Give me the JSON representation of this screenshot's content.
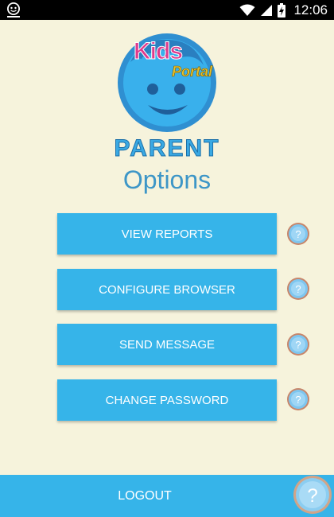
{
  "status_bar": {
    "time": "12:06",
    "icons": [
      "app-notification-icon",
      "wifi-icon",
      "cell-signal-icon",
      "battery-charging-icon"
    ]
  },
  "logo": {
    "kids": "Kids",
    "portal": "Portal"
  },
  "header": {
    "brand": "PARENT",
    "title": "Options"
  },
  "options": {
    "view_reports": "VIEW REPORTS",
    "configure_browser": "CONFIGURE BROWSER",
    "send_message": "SEND MESSAGE",
    "change_password": "CHANGE PASSWORD"
  },
  "footer": {
    "logout": "LOGOUT"
  },
  "colors": {
    "accent": "#36b4e9",
    "background": "#f6f3dc",
    "title": "#3d96c7"
  }
}
